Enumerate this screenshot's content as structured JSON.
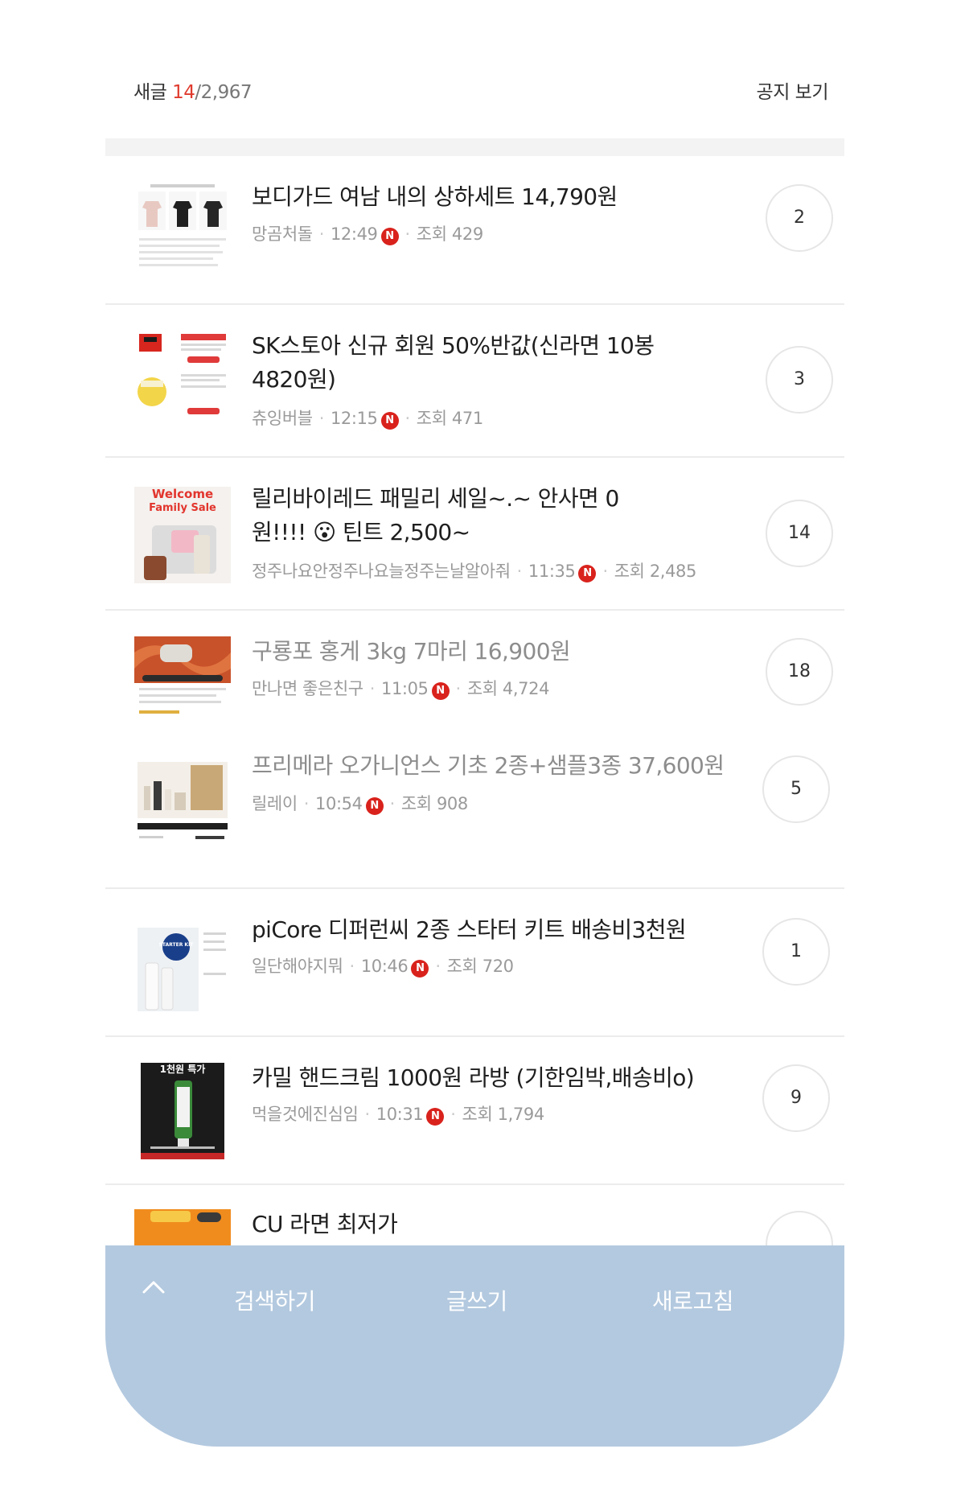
{
  "header": {
    "new_label": "새글",
    "new_count": "14",
    "separator": "/",
    "total_count": "2,967",
    "notice_label": "공지 보기"
  },
  "posts": [
    {
      "title": "보디가드 여남 내의 상하세트 14,790원",
      "author": "망곰처돌",
      "time": "12:49",
      "badge": "N",
      "views": "조회 429",
      "replies": "2",
      "read": false
    },
    {
      "title": "SK스토아 신규 회원 50%반값(신라면 10봉 4820원)",
      "author": "츄잉버블",
      "time": "12:15",
      "badge": "N",
      "views": "조회 471",
      "replies": "3",
      "read": false
    },
    {
      "title": "릴리바이레드 패밀리 세일~.~ 안사면 0원!!!! 😮 틴트 2,500~",
      "author": "정주나요안정주나요늘정주는날알아줘",
      "time": "11:35",
      "badge": "N",
      "views": "조회 2,485",
      "replies": "14",
      "read": false
    },
    {
      "title": "구룡포 홍게 3kg 7마리 16,900원",
      "author": "만나면 좋은친구",
      "time": "11:05",
      "badge": "N",
      "views": "조회 4,724",
      "replies": "18",
      "read": true
    },
    {
      "title": "프리메라 오가니언스 기초 2종+샘플3종 37,600원",
      "author": "릴레이",
      "time": "10:54",
      "badge": "N",
      "views": "조회 908",
      "replies": "5",
      "read": true
    },
    {
      "title": "piCore 디퍼런씨 2종 스타터 키트 배송비3천원",
      "author": "일단해야지뭐",
      "time": "10:46",
      "badge": "N",
      "views": "조회 720",
      "replies": "1",
      "read": false
    },
    {
      "title": "카밀 핸드크림 1000원 라방 (기한임박,배송비o)",
      "author": "먹을것에진심임",
      "time": "10:31",
      "badge": "N",
      "views": "조회 1,794",
      "replies": "9",
      "read": false
    },
    {
      "title": "CU 라면 최저가",
      "author": "",
      "time": "",
      "badge": "",
      "views": "",
      "replies": "",
      "read": false
    }
  ],
  "thumb_text": {
    "welcome": "Welcome",
    "family_sale": "Family Sale",
    "starter_kit": "STARTER KIT",
    "camill_banner": "1천원 특가"
  },
  "toolbar": {
    "up_icon": "chevron-up-icon",
    "search_label": "검색하기",
    "write_label": "글쓰기",
    "refresh_label": "새로고침"
  },
  "colors": {
    "accent_red": "#e03b2e",
    "badge_red": "#d9221c",
    "toolbar_bg": "#b3c9df"
  }
}
